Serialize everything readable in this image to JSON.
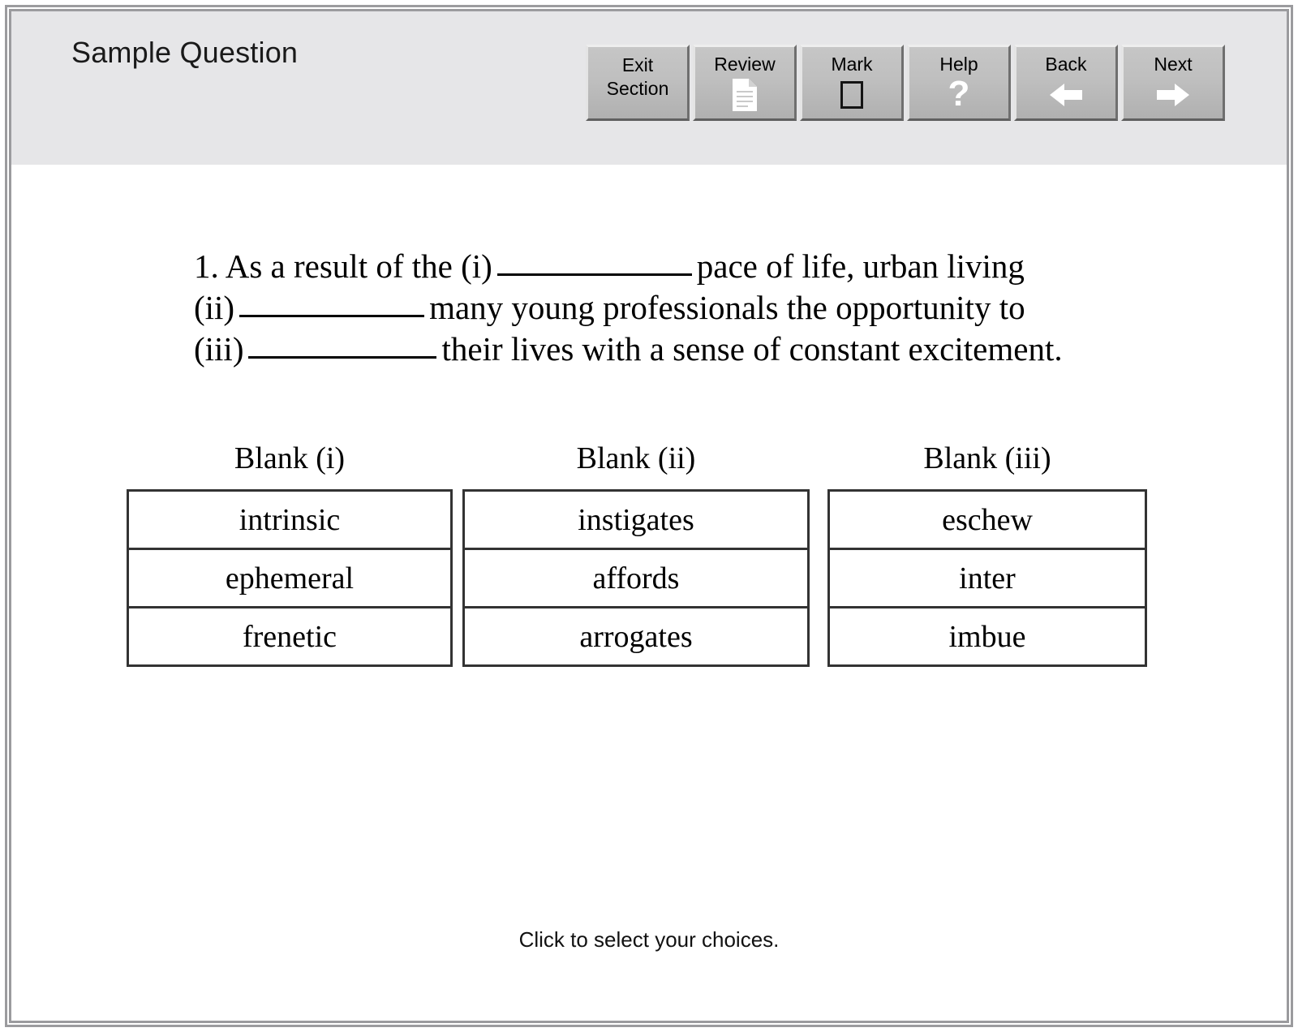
{
  "header": {
    "title": "Sample Question",
    "buttons": [
      {
        "label": "Exit\nSection",
        "label_line1": "Exit",
        "label_line2": "Section",
        "icon": "none",
        "name": "exit-section-button"
      },
      {
        "label": "Review",
        "label_line1": "Review",
        "label_line2": "",
        "icon": "document-icon",
        "name": "review-button"
      },
      {
        "label": "Mark",
        "label_line1": "Mark",
        "label_line2": "",
        "icon": "checkbox-icon",
        "name": "mark-button"
      },
      {
        "label": "Help",
        "label_line1": "Help",
        "label_line2": "",
        "icon": "question-mark-icon",
        "name": "help-button"
      },
      {
        "label": "Back",
        "label_line1": "Back",
        "label_line2": "",
        "icon": "arrow-left-icon",
        "name": "back-button"
      },
      {
        "label": "Next",
        "label_line1": "Next",
        "label_line2": "",
        "icon": "arrow-right-icon",
        "name": "next-button"
      }
    ]
  },
  "question": {
    "number": "1.",
    "line1_before": "1. As a result of the (i)",
    "line1_after": "pace of life, urban living",
    "line2_before": "(ii)",
    "line2_after": "many young professionals the opportunity to",
    "line3_before": "(iii)",
    "line3_after": "their lives with a sense of constant excitement.",
    "full_text": "1. As a result of the (i) ____________ pace of life, urban living (ii) ____________ many young professionals the opportunity to (iii) ____________ their lives with a sense of constant excitement."
  },
  "answers": {
    "columns": [
      {
        "heading": "Blank (i)",
        "options": [
          "intrinsic",
          "ephemeral",
          "frenetic"
        ]
      },
      {
        "heading": "Blank (ii)",
        "options": [
          "instigates",
          "affords",
          "arrogates"
        ]
      },
      {
        "heading": "Blank (iii)",
        "options": [
          "eschew",
          "inter",
          "imbue"
        ]
      }
    ]
  },
  "footer": {
    "instruction": "Click to select your choices."
  },
  "colors": {
    "header_background": "#e6e6e8",
    "frame_border": "#9b9b9e",
    "button_face": "#bfbfbf",
    "button_light_bevel": "#eeeeee",
    "button_dark_bevel": "#5f5f5f",
    "table_border": "#333333",
    "text": "#000000",
    "page_background": "#ffffff"
  }
}
